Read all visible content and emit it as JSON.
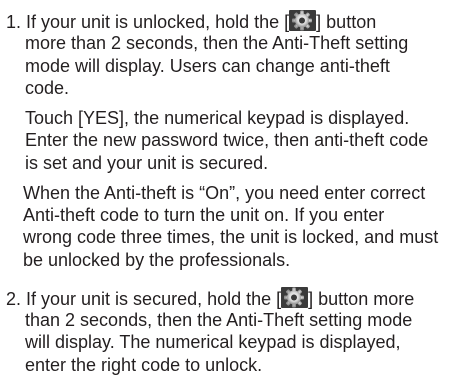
{
  "icons": {
    "settings_button": "gear-icon"
  },
  "colors": {
    "text": "#231f20",
    "icon_bg": "#3a3a3a"
  },
  "item1": {
    "line1_before": "1. If your unit is unlocked, hold the [",
    "line1_after": "] button",
    "line2": "more than 2 seconds, then the Anti-Theft setting",
    "line3": "mode will display. Users can change anti-theft",
    "line4": "code."
  },
  "para2": {
    "line1": "Touch [YES], the numerical keypad is displayed.",
    "line2": "Enter the new password twice, then anti-theft code",
    "line3": "is set and your unit is secured."
  },
  "para3": {
    "line1": "When the Anti-theft is “On”, you need enter correct",
    "line2": "Anti-theft code to turn the unit on. If you enter",
    "line3": "wrong code three times, the unit is locked, and must",
    "line4": "be unlocked by the professionals."
  },
  "item2": {
    "line1_before": "2. If your unit is secured, hold the [",
    "line1_after": "] button more",
    "line2": "than 2 seconds, then the Anti-Theft setting mode",
    "line3": "will display. The numerical keypad is displayed,",
    "line4": "enter the right code to unlock."
  }
}
